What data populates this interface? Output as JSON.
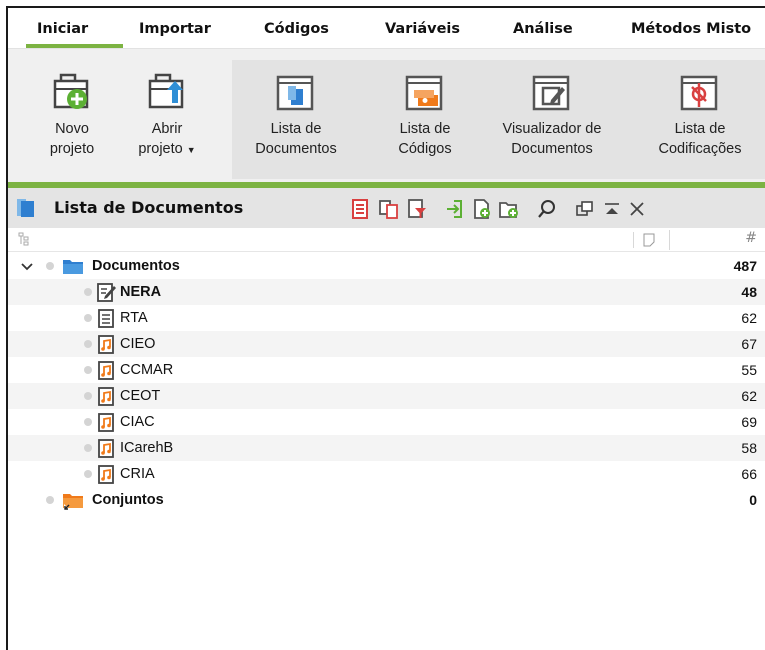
{
  "ribbon": {
    "tabs": [
      "Iniciar",
      "Importar",
      "Códigos",
      "Variáveis",
      "Análise",
      "Métodos Misto"
    ],
    "buttons": {
      "new_project": {
        "line1": "Novo",
        "line2": "projeto",
        "icon": "new-project-icon"
      },
      "open_project": {
        "line1": "Abrir",
        "line2": "projeto",
        "icon": "open-project-icon"
      },
      "document_list": {
        "line1": "Lista de",
        "line2": "Documentos",
        "icon": "document-list-icon"
      },
      "code_list": {
        "line1": "Lista de",
        "line2": "Códigos",
        "icon": "code-list-icon"
      },
      "document_viewer": {
        "line1": "Visualizador de",
        "line2": "Documentos",
        "icon": "document-viewer-icon"
      },
      "coding_list": {
        "line1": "Lista de",
        "line2": "Codificações",
        "icon": "coding-list-icon"
      }
    },
    "accent_color": "#7cb342"
  },
  "panel": {
    "title": "Lista de Documentos",
    "column_count_symbol": "#"
  },
  "tree": {
    "root": {
      "label": "Documentos",
      "count": "487",
      "expanded": true
    },
    "documents": [
      {
        "name": "NERA",
        "count": "48",
        "type": "text-edited",
        "bold": true
      },
      {
        "name": "RTA",
        "count": "62",
        "type": "text"
      },
      {
        "name": "CIEO",
        "count": "67",
        "type": "audio"
      },
      {
        "name": "CCMAR",
        "count": "55",
        "type": "audio"
      },
      {
        "name": "CEOT",
        "count": "62",
        "type": "audio"
      },
      {
        "name": "CIAC",
        "count": "69",
        "type": "audio"
      },
      {
        "name": "ICarehB",
        "count": "58",
        "type": "audio"
      },
      {
        "name": "CRIA",
        "count": "66",
        "type": "audio"
      }
    ],
    "sets": {
      "label": "Conjuntos",
      "count": "0"
    }
  }
}
